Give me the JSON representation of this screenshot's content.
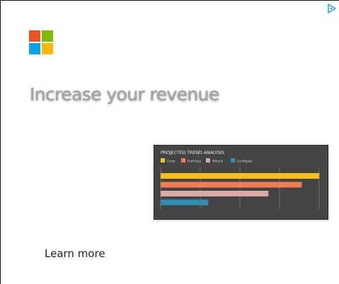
{
  "ad": {
    "headline": "Increase your revenue",
    "cta_label": "Learn more",
    "adchoices_icon": "adchoices-icon",
    "brand_logo_icon": "microsoft-logo-icon",
    "logo_colors": [
      "#f25022",
      "#7fba00",
      "#00a4ef",
      "#ffb900"
    ]
  },
  "chart_data": {
    "type": "bar",
    "orientation": "horizontal",
    "title": "PROJECTED TREND ANALYSIS",
    "legend_position": "top-left",
    "grid": true,
    "xlim": [
      0,
      100
    ],
    "series": [
      {
        "name": "Crew",
        "color": "#f5c018",
        "value": 100
      },
      {
        "name": "Half-Day",
        "color": "#f47c50",
        "value": 89
      },
      {
        "name": "Whack",
        "color": "#dba9a7",
        "value": 68
      },
      {
        "name": "Configure",
        "color": "#2f8fb0",
        "value": 30
      }
    ]
  }
}
